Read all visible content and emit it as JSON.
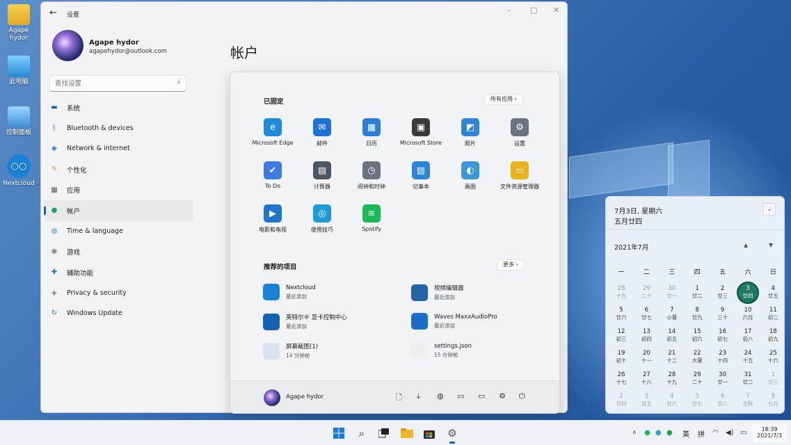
{
  "desktop": {
    "icons": [
      {
        "label": "Agape hydor",
        "icon": "folder-icon"
      },
      {
        "label": "此电脑",
        "icon": "computer-icon"
      },
      {
        "label": "控制面板",
        "icon": "control-panel-icon"
      },
      {
        "label": "Nextcloud",
        "icon": "nextcloud-icon"
      }
    ]
  },
  "settings": {
    "title": "设置",
    "user": {
      "name": "Agape hydor",
      "email": "agapehydor@outlook.com"
    },
    "search_placeholder": "查找设置",
    "page_title": "帐户",
    "nav": [
      {
        "label": "系统",
        "icon": "system-icon",
        "color": "#0067c0"
      },
      {
        "label": "Bluetooth & devices",
        "icon": "bluetooth-icon",
        "color": "#0078d4"
      },
      {
        "label": "Network & internet",
        "icon": "wifi-icon",
        "color": "#3a8ee6"
      },
      {
        "label": "个性化",
        "icon": "brush-icon",
        "color": "#d48a3c"
      },
      {
        "label": "应用",
        "icon": "apps-icon",
        "color": "#555c66"
      },
      {
        "label": "帐户",
        "icon": "account-icon",
        "color": "#1ca27a"
      },
      {
        "label": "Time & language",
        "icon": "globe-icon",
        "color": "#2d8fd6"
      },
      {
        "label": "游戏",
        "icon": "gamepad-icon",
        "color": "#777c85"
      },
      {
        "label": "辅助功能",
        "icon": "accessibility-icon",
        "color": "#1e73c8"
      },
      {
        "label": "Privacy & security",
        "icon": "shield-icon",
        "color": "#7d828a"
      },
      {
        "label": "Windows Update",
        "icon": "update-icon",
        "color": "#1e73c8"
      }
    ],
    "active_nav": "帐户"
  },
  "start_menu": {
    "pinned_title": "已固定",
    "all_apps_label": "所有应用",
    "pinned": [
      {
        "label": "Microsoft Edge",
        "icon": "edge-icon",
        "color": "#1f8ad9"
      },
      {
        "label": "邮件",
        "icon": "mail-icon",
        "color": "#1a73d9"
      },
      {
        "label": "日历",
        "icon": "calendar-icon",
        "color": "#2b7fd4"
      },
      {
        "label": "Microsoft Store",
        "icon": "store-icon",
        "color": "#3a3a3a"
      },
      {
        "label": "照片",
        "icon": "photos-icon",
        "color": "#2f84d6"
      },
      {
        "label": "设置",
        "icon": "gear-icon",
        "color": "#6b7380"
      },
      {
        "label": "To Do",
        "icon": "todo-icon",
        "color": "#3d7be0"
      },
      {
        "label": "计算器",
        "icon": "calculator-icon",
        "color": "#4b5563"
      },
      {
        "label": "闹钟和时钟",
        "icon": "clock-icon",
        "color": "#6b7280"
      },
      {
        "label": "记事本",
        "icon": "notepad-icon",
        "color": "#2b86d8"
      },
      {
        "label": "画图",
        "icon": "paint-icon",
        "color": "#3b9ad6"
      },
      {
        "label": "文件资源管理器",
        "icon": "folder-icon",
        "color": "#e8b220"
      },
      {
        "label": "电影和电视",
        "icon": "movies-icon",
        "color": "#1f73c8"
      },
      {
        "label": "使用技巧",
        "icon": "tips-icon",
        "color": "#1e9ad6"
      },
      {
        "label": "Spotify",
        "icon": "spotify-icon",
        "color": "#1db954"
      }
    ],
    "recommended_title": "推荐的项目",
    "more_label": "更多",
    "recommended": [
      {
        "name": "Nextcloud",
        "sub": "最近添加",
        "icon": "nextcloud-icon",
        "color": "#1a82d6"
      },
      {
        "name": "视频编辑器",
        "sub": "最近添加",
        "icon": "video-editor-icon",
        "color": "#2563a8"
      },
      {
        "name": "英特尔® 显卡控制中心",
        "sub": "最近添加",
        "icon": "intel-graphics-icon",
        "color": "#1560b8"
      },
      {
        "name": "Waves MaxxAudioPro",
        "sub": "最近添加",
        "icon": "waves-icon",
        "color": "#1a6fc9"
      },
      {
        "name": "屏幕截图(1)",
        "sub": "14 分钟前",
        "icon": "image-file-icon",
        "color": "#d7e3f0"
      },
      {
        "name": "settings.json",
        "sub": "15 分钟前",
        "icon": "file-icon",
        "color": "#eeeeee"
      }
    ],
    "user_name": "Agape hydor",
    "footer_icons": [
      "document-icon",
      "download-icon",
      "network-icon",
      "folder-user-icon",
      "folder-icon",
      "gear-icon",
      "power-icon"
    ]
  },
  "calendar": {
    "date_line": "7月3日, 星期六",
    "lunar_line": "五月廿四",
    "month_label": "2021年7月",
    "weekdays": [
      "一",
      "二",
      "三",
      "四",
      "五",
      "六",
      "日"
    ],
    "today": "3",
    "weeks": [
      [
        {
          "d": "28",
          "l": "十九",
          "o": true
        },
        {
          "d": "29",
          "l": "二十",
          "o": true
        },
        {
          "d": "30",
          "l": "廿一",
          "o": true
        },
        {
          "d": "1",
          "l": "廿二"
        },
        {
          "d": "2",
          "l": "廿三"
        },
        {
          "d": "3",
          "l": "廿四",
          "t": true
        },
        {
          "d": "4",
          "l": "廿五"
        }
      ],
      [
        {
          "d": "5",
          "l": "廿六"
        },
        {
          "d": "6",
          "l": "廿七"
        },
        {
          "d": "7",
          "l": "小暑"
        },
        {
          "d": "8",
          "l": "廿九"
        },
        {
          "d": "9",
          "l": "三十"
        },
        {
          "d": "10",
          "l": "六月"
        },
        {
          "d": "11",
          "l": "初二"
        }
      ],
      [
        {
          "d": "12",
          "l": "初三"
        },
        {
          "d": "13",
          "l": "初四"
        },
        {
          "d": "14",
          "l": "初五"
        },
        {
          "d": "15",
          "l": "初六"
        },
        {
          "d": "16",
          "l": "初七"
        },
        {
          "d": "17",
          "l": "初八"
        },
        {
          "d": "18",
          "l": "初九"
        }
      ],
      [
        {
          "d": "19",
          "l": "初十"
        },
        {
          "d": "20",
          "l": "十一"
        },
        {
          "d": "21",
          "l": "十二"
        },
        {
          "d": "22",
          "l": "大暑"
        },
        {
          "d": "23",
          "l": "十四"
        },
        {
          "d": "24",
          "l": "十五"
        },
        {
          "d": "25",
          "l": "十六"
        }
      ],
      [
        {
          "d": "26",
          "l": "十七"
        },
        {
          "d": "27",
          "l": "十八"
        },
        {
          "d": "28",
          "l": "十九"
        },
        {
          "d": "29",
          "l": "二十"
        },
        {
          "d": "30",
          "l": "廿一"
        },
        {
          "d": "31",
          "l": "廿二"
        },
        {
          "d": "1",
          "l": "廿三",
          "o": true
        }
      ],
      [
        {
          "d": "2",
          "l": "廿四",
          "o": true
        },
        {
          "d": "3",
          "l": "廿五",
          "o": true
        },
        {
          "d": "4",
          "l": "廿六",
          "o": true
        },
        {
          "d": "5",
          "l": "廿七",
          "o": true
        },
        {
          "d": "6",
          "l": "廿八",
          "o": true
        },
        {
          "d": "7",
          "l": "立秋",
          "o": true
        },
        {
          "d": "8",
          "l": "七月",
          "o": true
        }
      ]
    ]
  },
  "taskbar": {
    "apps": [
      "start-icon",
      "search-icon",
      "task-view-icon",
      "file-explorer-icon",
      "store-icon",
      "settings-icon"
    ],
    "ime_lang": "英",
    "ime_mode": "拼",
    "time": "18:39",
    "date": "2021/7/3"
  }
}
